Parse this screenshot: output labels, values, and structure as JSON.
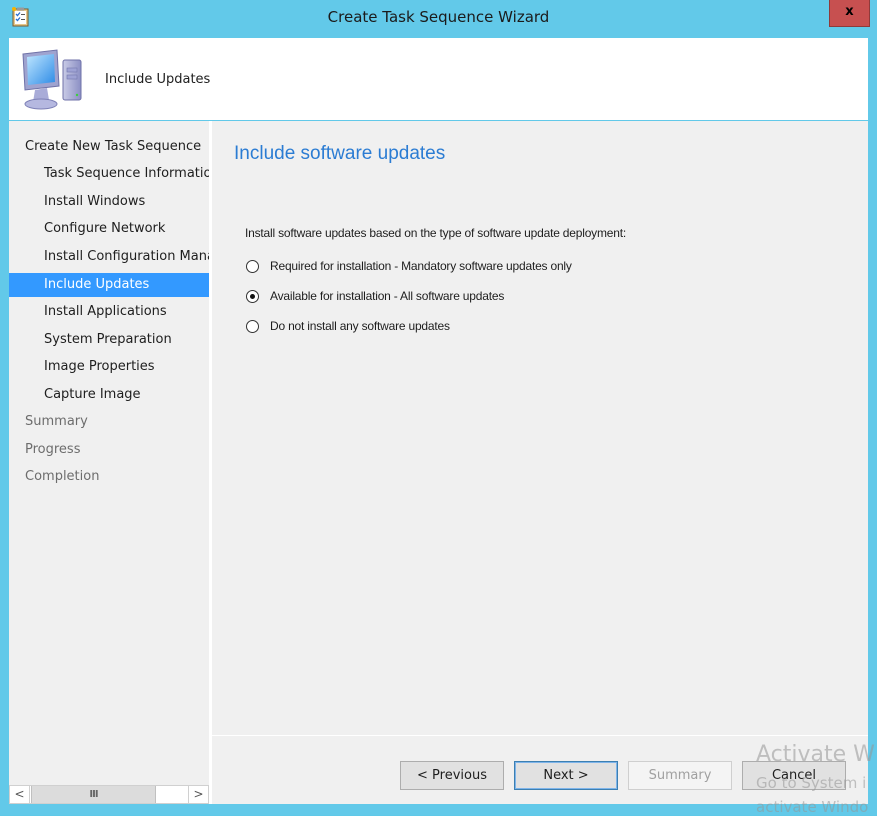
{
  "window": {
    "title": "Create Task Sequence Wizard",
    "close_label": "x"
  },
  "header": {
    "title": "Include Updates",
    "icon": "computer-icon"
  },
  "sidebar": {
    "items": [
      {
        "label": "Create New Task Sequence",
        "level": "top",
        "state": "normal"
      },
      {
        "label": "Task Sequence Information",
        "level": "sub",
        "state": "normal"
      },
      {
        "label": "Install Windows",
        "level": "sub",
        "state": "normal"
      },
      {
        "label": "Configure Network",
        "level": "sub",
        "state": "normal"
      },
      {
        "label": "Install Configuration Manager",
        "level": "sub",
        "state": "normal"
      },
      {
        "label": "Include Updates",
        "level": "sub",
        "state": "active"
      },
      {
        "label": "Install Applications",
        "level": "sub",
        "state": "normal"
      },
      {
        "label": "System Preparation",
        "level": "sub",
        "state": "normal"
      },
      {
        "label": "Image Properties",
        "level": "sub",
        "state": "normal"
      },
      {
        "label": "Capture Image",
        "level": "sub",
        "state": "normal"
      },
      {
        "label": "Summary",
        "level": "top",
        "state": "disabled"
      },
      {
        "label": "Progress",
        "level": "top",
        "state": "disabled"
      },
      {
        "label": "Completion",
        "level": "top",
        "state": "disabled"
      }
    ],
    "scrollbar": {
      "left_arrow": "<",
      "right_arrow": ">",
      "thumb_grip": "III"
    }
  },
  "content": {
    "title": "Include software updates",
    "description": "Install software updates based on the type of software update deployment:",
    "options": [
      {
        "label": "Required for installation - Mandatory software updates only",
        "checked": false
      },
      {
        "label": "Available for installation - All software updates",
        "checked": true
      },
      {
        "label": "Do not install any software updates",
        "checked": false
      }
    ]
  },
  "footer": {
    "previous_label": "< Previous",
    "next_label": "Next >",
    "summary_label": "Summary",
    "cancel_label": "Cancel"
  },
  "watermark": {
    "line1": "Activate W",
    "line2": "Go to System i",
    "line3": "activate Windo"
  },
  "colors": {
    "title_bar": "#62c9e9",
    "accent_heading": "#2b7cd3",
    "selection": "#3399ff",
    "close_button": "#c75050"
  }
}
